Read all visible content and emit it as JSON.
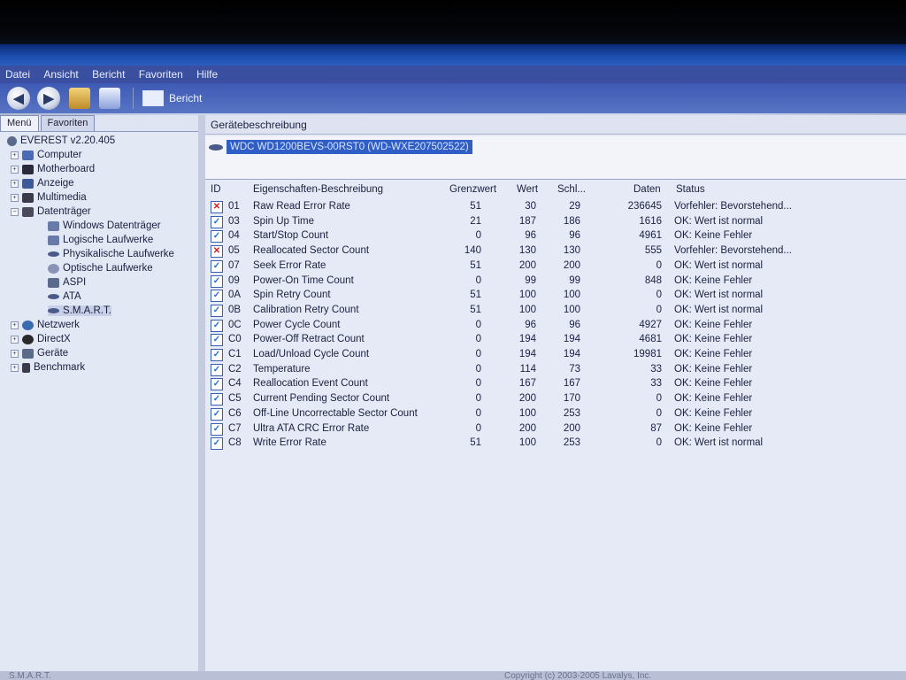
{
  "menu": [
    "Datei",
    "Ansicht",
    "Bericht",
    "Favoriten",
    "Hilfe"
  ],
  "toolbar": {
    "report_label": "Bericht"
  },
  "left_tabs": [
    "Menü",
    "Favoriten"
  ],
  "tree": [
    {
      "label": "EVEREST v2.20.405"
    },
    {
      "label": "Computer"
    },
    {
      "label": "Motherboard"
    },
    {
      "label": "Anzeige"
    },
    {
      "label": "Multimedia"
    },
    {
      "label": "Datenträger"
    },
    {
      "label": "Windows Datenträger"
    },
    {
      "label": "Logische Laufwerke"
    },
    {
      "label": "Physikalische Laufwerke"
    },
    {
      "label": "Optische Laufwerke"
    },
    {
      "label": "ASPI"
    },
    {
      "label": "ATA"
    },
    {
      "label": "S.M.A.R.T."
    },
    {
      "label": "Netzwerk"
    },
    {
      "label": "DirectX"
    },
    {
      "label": "Geräte"
    },
    {
      "label": "Benchmark"
    }
  ],
  "device": {
    "header": "Gerätebeschreibung",
    "selected": "WDC WD1200BEVS-00RST0 (WD-WXE207502522)"
  },
  "columns": [
    "ID",
    "Eigenschaften-Beschreibung",
    "Grenzwert",
    "Wert",
    "Schl...",
    "Daten",
    "Status"
  ],
  "rows": [
    {
      "id": "01",
      "name": "Raw Read Error Rate",
      "threshold": "51",
      "value": "30",
      "worst": "29",
      "data": "236645",
      "status": "Vorfehler: Bevorstehend...",
      "ok": false
    },
    {
      "id": "03",
      "name": "Spin Up Time",
      "threshold": "21",
      "value": "187",
      "worst": "186",
      "data": "1616",
      "status": "OK: Wert ist normal",
      "ok": true
    },
    {
      "id": "04",
      "name": "Start/Stop Count",
      "threshold": "0",
      "value": "96",
      "worst": "96",
      "data": "4961",
      "status": "OK: Keine Fehler",
      "ok": true
    },
    {
      "id": "05",
      "name": "Reallocated Sector Count",
      "threshold": "140",
      "value": "130",
      "worst": "130",
      "data": "555",
      "status": "Vorfehler: Bevorstehend...",
      "ok": false
    },
    {
      "id": "07",
      "name": "Seek Error Rate",
      "threshold": "51",
      "value": "200",
      "worst": "200",
      "data": "0",
      "status": "OK: Wert ist normal",
      "ok": true
    },
    {
      "id": "09",
      "name": "Power-On Time Count",
      "threshold": "0",
      "value": "99",
      "worst": "99",
      "data": "848",
      "status": "OK: Keine Fehler",
      "ok": true
    },
    {
      "id": "0A",
      "name": "Spin Retry Count",
      "threshold": "51",
      "value": "100",
      "worst": "100",
      "data": "0",
      "status": "OK: Wert ist normal",
      "ok": true
    },
    {
      "id": "0B",
      "name": "Calibration Retry Count",
      "threshold": "51",
      "value": "100",
      "worst": "100",
      "data": "0",
      "status": "OK: Wert ist normal",
      "ok": true
    },
    {
      "id": "0C",
      "name": "Power Cycle Count",
      "threshold": "0",
      "value": "96",
      "worst": "96",
      "data": "4927",
      "status": "OK: Keine Fehler",
      "ok": true
    },
    {
      "id": "C0",
      "name": "Power-Off Retract Count",
      "threshold": "0",
      "value": "194",
      "worst": "194",
      "data": "4681",
      "status": "OK: Keine Fehler",
      "ok": true
    },
    {
      "id": "C1",
      "name": "Load/Unload Cycle Count",
      "threshold": "0",
      "value": "194",
      "worst": "194",
      "data": "19981",
      "status": "OK: Keine Fehler",
      "ok": true
    },
    {
      "id": "C2",
      "name": "Temperature",
      "threshold": "0",
      "value": "114",
      "worst": "73",
      "data": "33",
      "status": "OK: Keine Fehler",
      "ok": true
    },
    {
      "id": "C4",
      "name": "Reallocation Event Count",
      "threshold": "0",
      "value": "167",
      "worst": "167",
      "data": "33",
      "status": "OK: Keine Fehler",
      "ok": true
    },
    {
      "id": "C5",
      "name": "Current Pending Sector Count",
      "threshold": "0",
      "value": "200",
      "worst": "170",
      "data": "0",
      "status": "OK: Keine Fehler",
      "ok": true
    },
    {
      "id": "C6",
      "name": "Off-Line Uncorrectable Sector Count",
      "threshold": "0",
      "value": "100",
      "worst": "253",
      "data": "0",
      "status": "OK: Keine Fehler",
      "ok": true
    },
    {
      "id": "C7",
      "name": "Ultra ATA CRC Error Rate",
      "threshold": "0",
      "value": "200",
      "worst": "200",
      "data": "87",
      "status": "OK: Keine Fehler",
      "ok": true
    },
    {
      "id": "C8",
      "name": "Write Error Rate",
      "threshold": "51",
      "value": "100",
      "worst": "253",
      "data": "0",
      "status": "OK: Wert ist normal",
      "ok": true
    }
  ],
  "statusbar": {
    "left": "S.M.A.R.T.",
    "right": "Copyright (c) 2003-2005 Lavalys, Inc."
  }
}
